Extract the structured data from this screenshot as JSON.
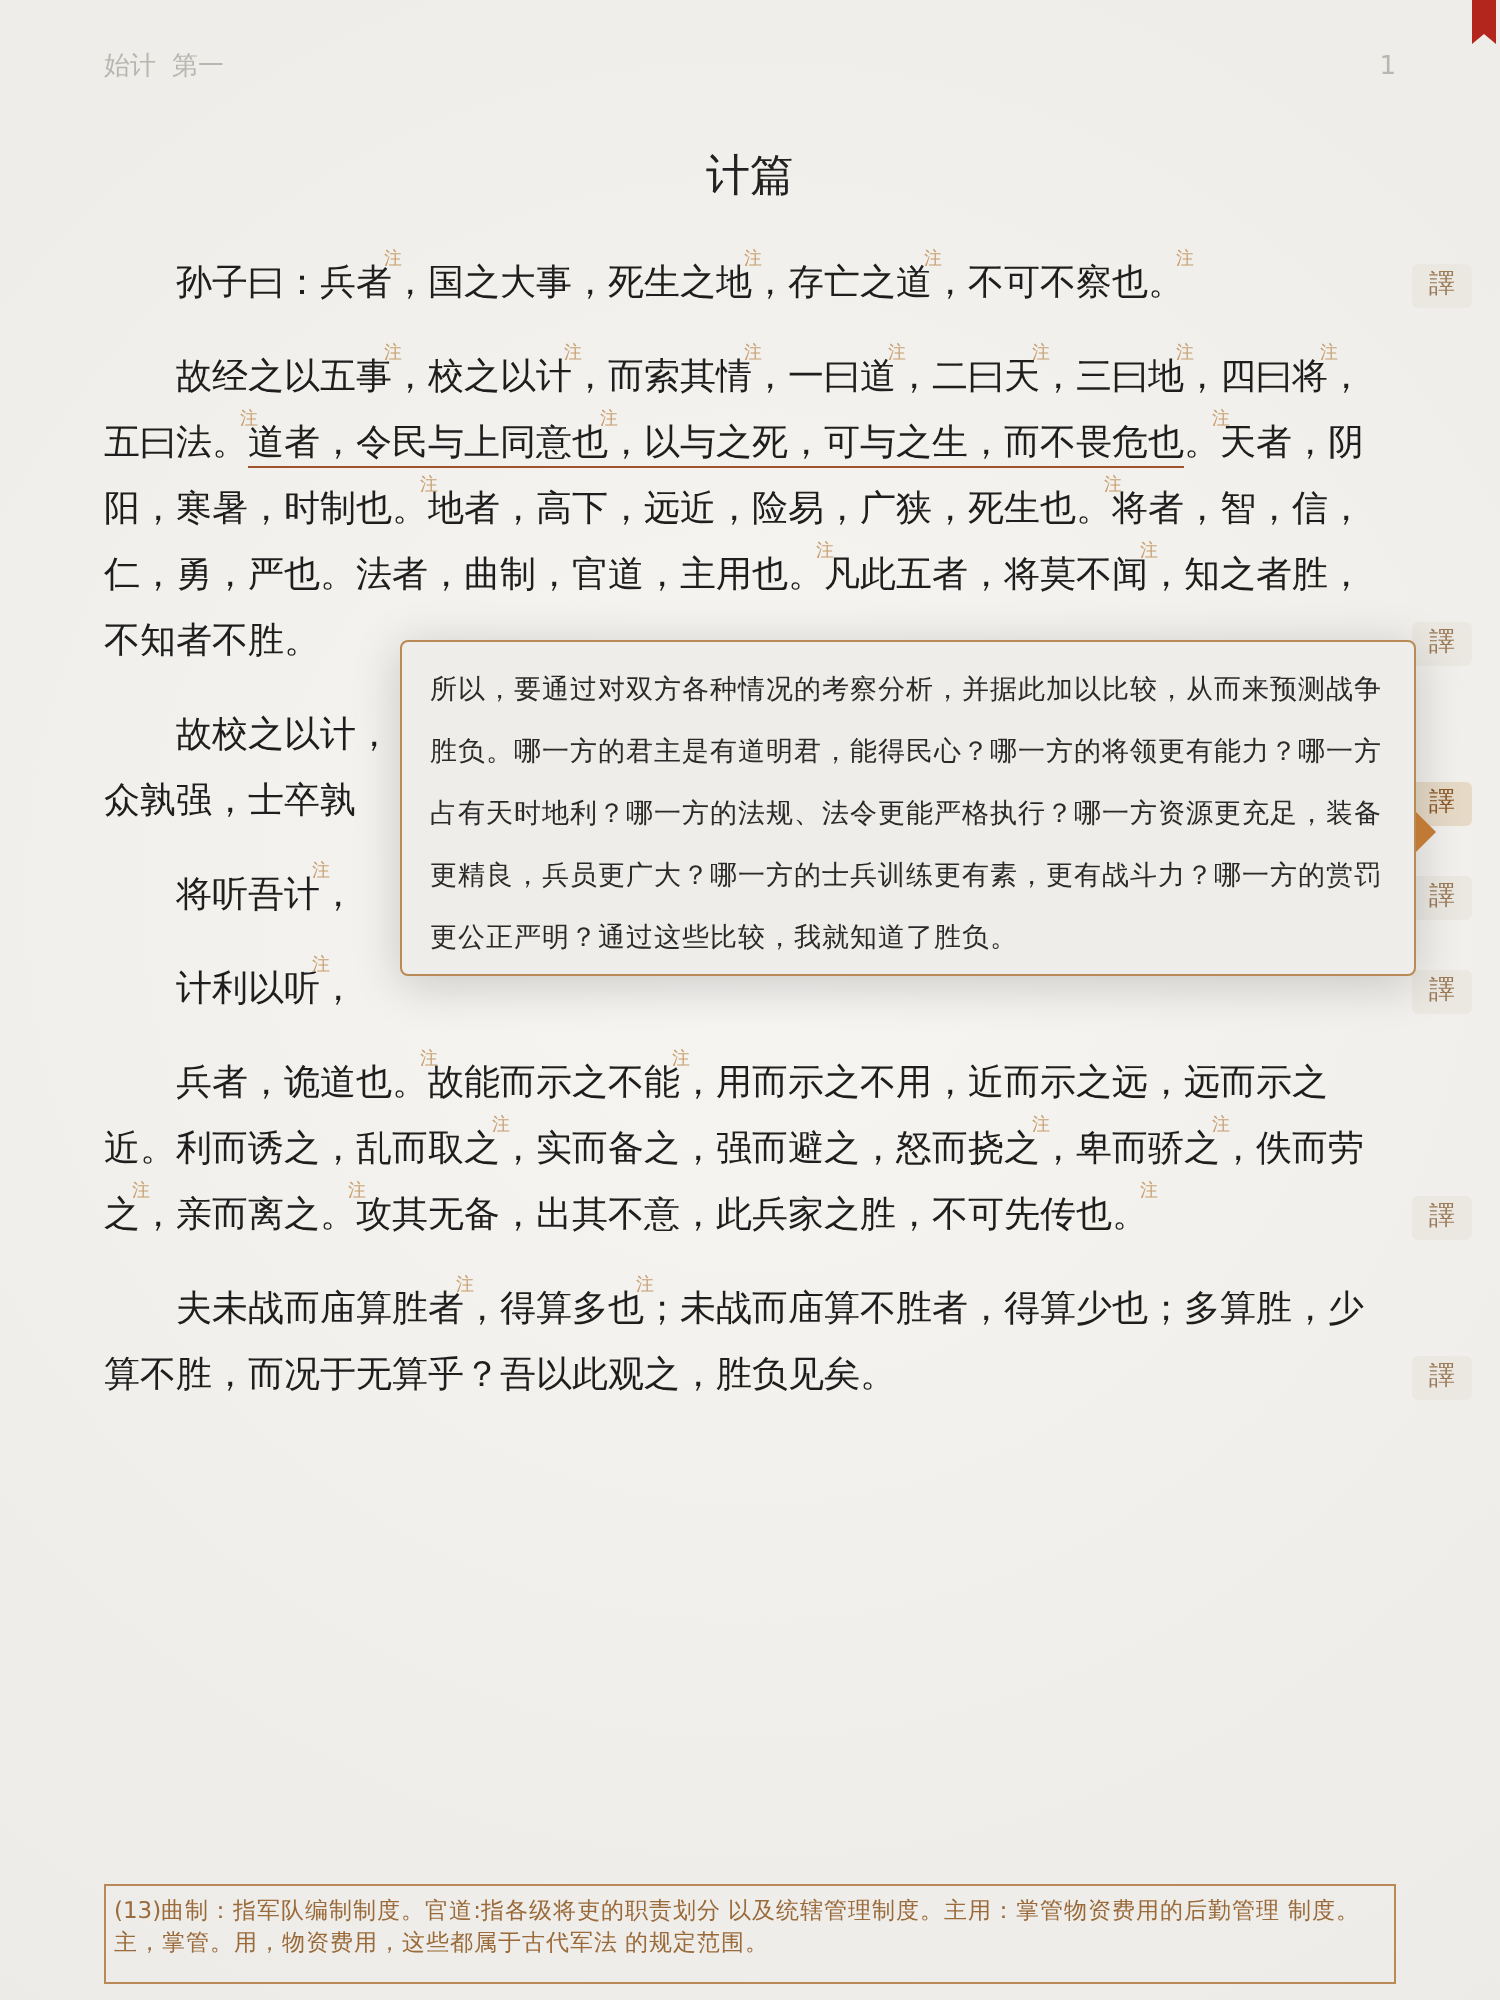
{
  "header": {
    "chapter": "始计",
    "section": "第一",
    "page": "1"
  },
  "title": "计篇",
  "paragraphs": [
    {
      "segments": [
        {
          "kind": "text",
          "text": "孙子曰：兵者$^{注}$，国之大事，死生之地$^{注}$，存亡之道$^{注}$，不可不察也。$^{注}$"
        }
      ],
      "translate": "譯",
      "selected": false
    },
    {
      "segments": [
        {
          "kind": "text",
          "text": "故经之以五事$^{注}$，校之以计$^{注}$，而索其情$^{注}$，一曰道$^{注}$，二曰天$^{注}$，三曰地$^{注}$，四曰将$^{注}$，五曰法。$^{注}$"
        },
        {
          "kind": "underline",
          "text": "道者，令民与上同意也$^{注}$，以与之死，可与之生，而不畏危也"
        },
        {
          "kind": "text",
          "text": "。$^{注}$天者，阴阳，寒暑，时制也。$^{注}$地者，高下，远近，险易，广狭，死生也。$^{注}$将者，智，信，仁，勇，严也。法者，曲制，官道，主用也。$^{注}$凡此五者，将莫不闻$^{注}$，知之者胜，不知者不胜。"
        }
      ],
      "translate": "譯",
      "selected": false
    },
    {
      "segments": [
        {
          "kind": "text",
          "text": "故校之以计，"
        },
        {
          "kind": "break"
        },
        {
          "kind": "text",
          "text": "众孰强，士卒孰"
        }
      ],
      "translate": "譯",
      "selected": true
    },
    {
      "segments": [
        {
          "kind": "text",
          "text": "将听吾计$^{注}$，"
        }
      ],
      "translate": "譯",
      "selected": false
    },
    {
      "segments": [
        {
          "kind": "text",
          "text": "计利以听$^{注}$，"
        }
      ],
      "translate": "譯",
      "selected": false
    },
    {
      "segments": [
        {
          "kind": "text",
          "text": "兵者，诡道也。$^{注}$故能而示之不能$^{注}$，用而示之不用，近而示之远，远而示之近。利而诱之，乱而取之$^{注}$，实而备之，强而避之，怒而挠之$^{注}$，卑而骄之$^{注}$，佚而劳之$^{注}$，亲而离之。$^{注}$攻其无备，出其不意，此兵家之胜，不可先传也。$^{注}$"
        }
      ],
      "translate": "譯",
      "selected": false
    },
    {
      "segments": [
        {
          "kind": "text",
          "text": "夫未战而庙算胜者$^{注}$，得算多也$^{注}$；未战而庙算不胜者，得算少也；多算胜，少算不胜，而况于无算乎？吾以此观之，胜负见矣。"
        }
      ],
      "translate": "譯",
      "selected": false
    }
  ],
  "popup": {
    "text": "所以，要通过对双方各种情况的考察分析，并据此加以比较，从而来预测战争胜负。哪一方的君主是有道明君，能得民心？哪一方的将领更有能力？哪一方占有天时地利？哪一方的法规、法令更能严格执行？哪一方资源更充足，装备更精良，兵员更广大？哪一方的士兵训练更有素，更有战斗力？哪一方的赏罚更公正严明？通过这些比较，我就知道了胜负。"
  },
  "footnote": "(13)曲制：指军队编制制度。官道:指各级将吏的职责划分 以及统辖管理制度。主用：掌管物资费用的后勤管理 制度。主，掌管。用，物资费用，这些都属于古代军法 的规定范围。"
}
